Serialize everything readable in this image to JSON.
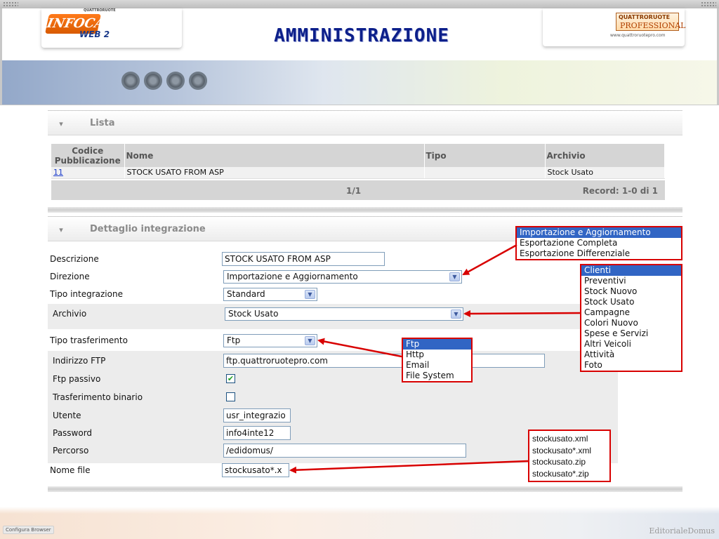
{
  "header": {
    "title": "AMMINISTRAZIONE",
    "logo_left": {
      "brand": "INFOCAR",
      "sub": "QUATTRORUOTE",
      "web": "WEB 2"
    },
    "logo_right": {
      "line1": "QUATTRORUOTE",
      "line2": "PROFESSIONAL",
      "url": "www.quattroruotepro.com"
    }
  },
  "lista": {
    "title": "Lista",
    "columns": [
      "Codice Pubblicazione",
      "Nome",
      "Tipo",
      "Archivio"
    ],
    "rows": [
      {
        "codice": "11",
        "nome": "STOCK USATO FROM ASP",
        "tipo": "",
        "archivio": "Stock Usato"
      }
    ],
    "page": "1/1",
    "records": "Record: 1-0 di 1"
  },
  "dettaglio": {
    "title": "Dettaglio integrazione",
    "fields": {
      "descrizione": {
        "label": "Descrizione",
        "value": "STOCK USATO FROM ASP"
      },
      "direzione": {
        "label": "Direzione",
        "value": "Importazione e Aggiornamento"
      },
      "tipo_integrazione": {
        "label": "Tipo integrazione",
        "value": "Standard"
      },
      "archivio": {
        "label": "Archivio",
        "value": "Stock Usato"
      },
      "tipo_trasferimento": {
        "label": "Tipo trasferimento",
        "value": "Ftp"
      },
      "indirizzo_ftp": {
        "label": "Indirizzo FTP",
        "value": "ftp.quattroruotepro.com"
      },
      "ftp_passivo": {
        "label": "Ftp passivo",
        "checked": true
      },
      "trasferimento_binario": {
        "label": "Trasferimento binario",
        "checked": false
      },
      "utente": {
        "label": "Utente",
        "value": "usr_integrazio"
      },
      "password": {
        "label": "Password",
        "value": "info4inte12"
      },
      "percorso": {
        "label": "Percorso",
        "value": "/edidomus/"
      },
      "nome_file": {
        "label": "Nome file",
        "value": "stockusato*.x"
      }
    }
  },
  "popups": {
    "direzione_options": [
      "Importazione e Aggiornamento",
      "Esportazione Completa",
      "Esportazione Differenziale"
    ],
    "archivio_options": [
      "Clienti",
      "Preventivi",
      "Stock Nuovo",
      "Stock Usato",
      "Campagne",
      "Colori Nuovo",
      "Spese e Servizi",
      "Altri Veicoli",
      "Attività",
      "Foto"
    ],
    "trasferimento_options": [
      "Ftp",
      "Http",
      "Email",
      "File System"
    ],
    "nome_file_options": [
      "stockusato.xml",
      "stockusato*.xml",
      "stockusato.zip",
      "stockusato*.zip"
    ]
  },
  "footer": {
    "configura": "Configura Browser",
    "brand": "EditorialeDomus"
  },
  "colors": {
    "title": "#0c1f8a",
    "callout_border": "#d80000",
    "selected": "#3165c4"
  }
}
